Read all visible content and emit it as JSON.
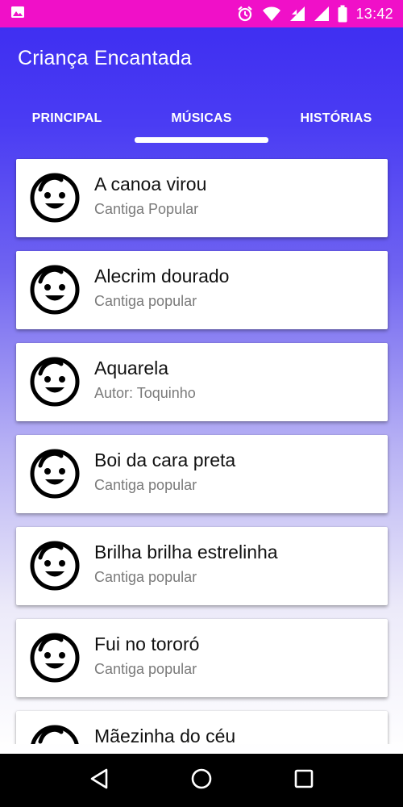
{
  "status_bar": {
    "time": "13:42",
    "icons": [
      "image-icon",
      "alarm-icon",
      "wifi-icon",
      "signal-icon",
      "signal-icon",
      "battery-icon"
    ]
  },
  "app": {
    "title": "Criança Encantada"
  },
  "tabs": [
    {
      "label": "PRINCIPAL"
    },
    {
      "label": "MÚSICAS"
    },
    {
      "label": "HISTÓRIAS"
    }
  ],
  "selected_tab": "MÚSICAS",
  "songs": [
    {
      "title": "A canoa virou",
      "subtitle": "Cantiga Popular",
      "icon": "baby-face-icon"
    },
    {
      "title": "Alecrim dourado",
      "subtitle": "Cantiga popular",
      "icon": "baby-face-icon"
    },
    {
      "title": "Aquarela",
      "subtitle": "Autor: Toquinho",
      "icon": "baby-face-icon"
    },
    {
      "title": "Boi da cara preta",
      "subtitle": "Cantiga popular",
      "icon": "baby-face-icon"
    },
    {
      "title": "Brilha brilha estrelinha",
      "subtitle": "Cantiga popular",
      "icon": "baby-face-icon"
    },
    {
      "title": "Fui no tororó",
      "subtitle": "Cantiga popular",
      "icon": "baby-face-icon"
    },
    {
      "title": "Mãezinha do céu",
      "subtitle": "",
      "icon": "baby-face-icon"
    }
  ],
  "nav_bar": {
    "buttons": [
      "back-icon",
      "home-icon",
      "recents-icon"
    ]
  },
  "colors": {
    "status_bar": "#f010c8",
    "header_top": "#3f2ff2",
    "card_bg": "#ffffff",
    "title_text": "#111111",
    "subtitle_text": "#7a7a7a"
  }
}
